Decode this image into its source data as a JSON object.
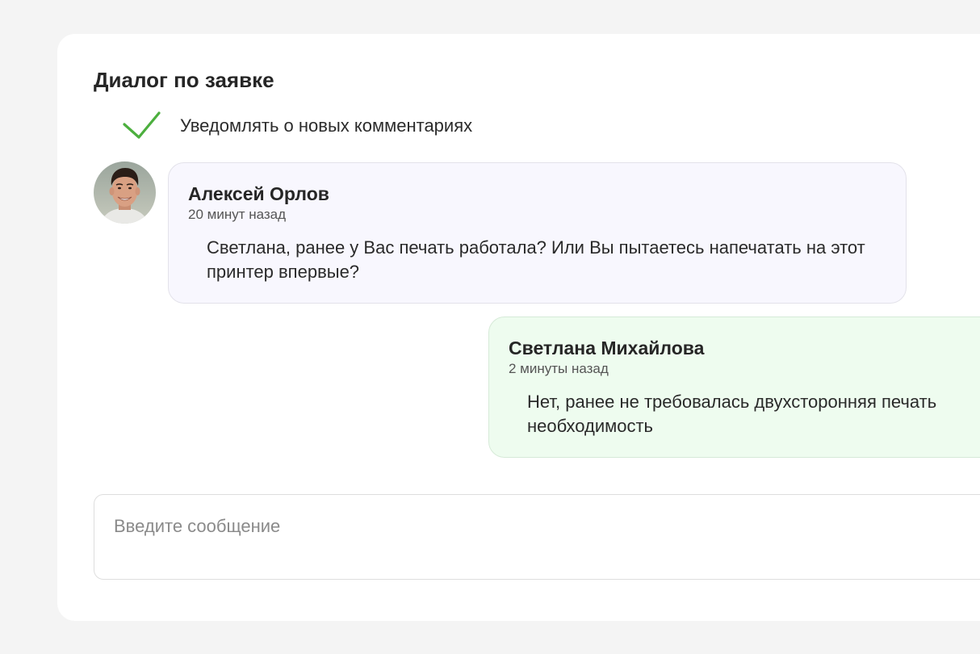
{
  "dialog": {
    "title": "Диалог по заявке",
    "notify_label": "Уведомлять о новых комментариях",
    "notify_checked": true
  },
  "messages": [
    {
      "author": "Алексей Орлов",
      "time": "20 минут назад",
      "text": "Светлана, ранее у Вас печать работала? Или Вы пытаетесь напечатать на этот принтер впервые?",
      "direction": "incoming"
    },
    {
      "author": "Светлана Михайлова",
      "time": "2 минуты назад",
      "text_line1": "Нет, ранее не требовалась двухсторонняя печать",
      "text_line2": "необходимость",
      "direction": "outgoing"
    }
  ],
  "composer": {
    "placeholder": "Введите сообщение"
  },
  "colors": {
    "check_green": "#4caf3e",
    "incoming_bg": "#f8f7fe",
    "outgoing_bg": "#eefcef"
  },
  "icons": {
    "notify": "checkmark-icon",
    "avatar": "user-avatar"
  }
}
